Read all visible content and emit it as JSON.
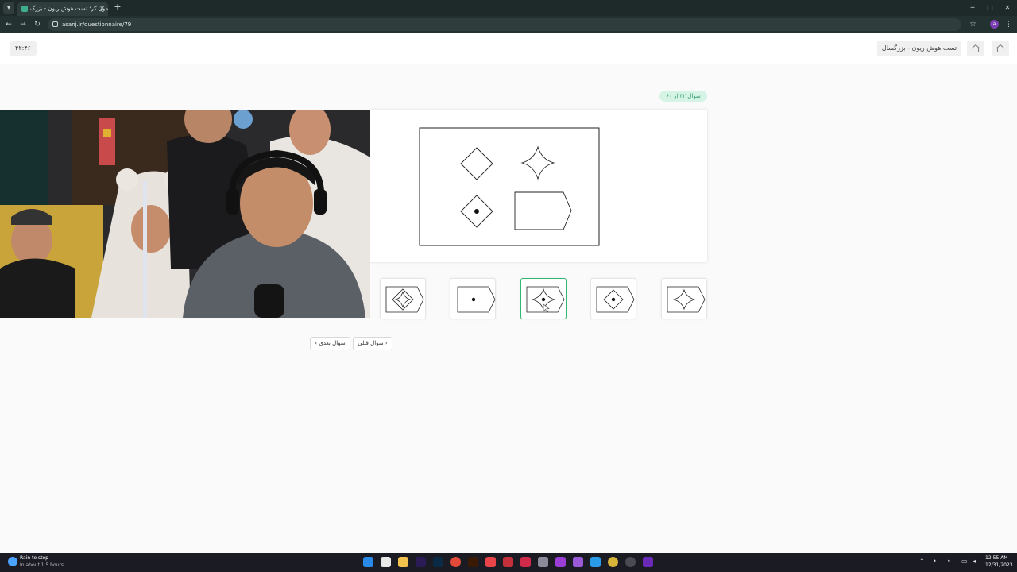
{
  "browser": {
    "tab_title": "آزمون گر؛ تست هوش ریون - بزرگ",
    "tab_close": "✕",
    "new_tab": "+",
    "url": "asanj.ir/questionnaire/79",
    "min": "─",
    "max": "▢",
    "close": "✕",
    "profile_initial": "a"
  },
  "header": {
    "timer": "۴۲:۴۶",
    "breadcrumb": "تست هوش ریون - بزرگسال"
  },
  "question": {
    "badge": "سوال ۳۲ از ۶۰"
  },
  "navigation": {
    "next_label": "سوال بعدی",
    "prev_label": "سوال قبلی"
  },
  "taskbar": {
    "weather_line1": "Rain to stop",
    "weather_line2": "In about 1.5 hours",
    "time": "12:55 AM",
    "date": "12/31/2023"
  },
  "colors": {
    "accent": "#2eb872",
    "badge_bg": "#d6f4e6"
  }
}
